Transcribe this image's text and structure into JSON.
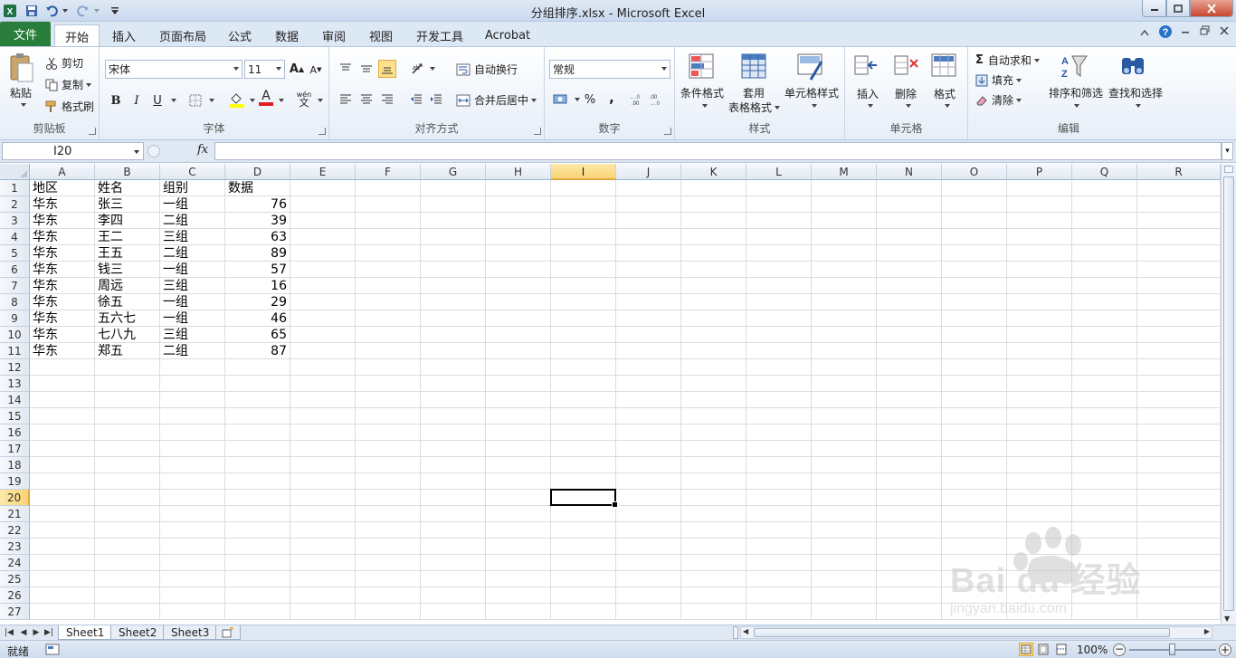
{
  "window": {
    "title": "分组排序.xlsx - Microsoft Excel"
  },
  "menu": {
    "tabs": [
      {
        "label": "文件"
      },
      {
        "label": "开始"
      },
      {
        "label": "插入"
      },
      {
        "label": "页面布局"
      },
      {
        "label": "公式"
      },
      {
        "label": "数据"
      },
      {
        "label": "审阅"
      },
      {
        "label": "视图"
      },
      {
        "label": "开发工具"
      },
      {
        "label": "Acrobat"
      }
    ],
    "active_tab": "开始"
  },
  "ribbon": {
    "clipboard": {
      "paste": "粘贴",
      "cut": "剪切",
      "copy": "复制",
      "format_painter": "格式刷",
      "label": "剪贴板"
    },
    "font": {
      "name": "宋体",
      "size": "11",
      "bold": "B",
      "italic": "I",
      "underline": "U",
      "label": "字体",
      "grow": "A",
      "shrink": "A",
      "color_a": "A",
      "phonetic": "wén"
    },
    "alignment": {
      "wrap_text": "自动换行",
      "merge_center": "合并后居中",
      "label": "对齐方式"
    },
    "number": {
      "format": "常规",
      "percent": "%",
      "comma": ",",
      "label": "数字"
    },
    "styles": {
      "conditional": "条件格式",
      "table_format_1": "套用",
      "table_format_2": "表格格式",
      "cell_styles": "单元格样式",
      "label": "样式"
    },
    "cells": {
      "insert": "插入",
      "delete": "删除",
      "format": "格式",
      "label": "单元格"
    },
    "editing": {
      "autosum": "自动求和",
      "fill": "填充",
      "clear": "清除",
      "sort_filter": "排序和筛选",
      "find_select": "查找和选择",
      "label": "编辑",
      "sigma": "Σ"
    }
  },
  "formula_bar": {
    "name_box": "I20",
    "fx": "fx",
    "value": ""
  },
  "sheet": {
    "columns": [
      "A",
      "B",
      "C",
      "D",
      "E",
      "F",
      "G",
      "H",
      "I",
      "J",
      "K",
      "L",
      "M",
      "N",
      "O",
      "P",
      "Q",
      "R"
    ],
    "row_numbers": [
      "1",
      "2",
      "3",
      "4",
      "5",
      "6",
      "7",
      "8",
      "9",
      "10",
      "11",
      "12",
      "13",
      "14",
      "15",
      "16",
      "17",
      "18",
      "19",
      "20",
      "21",
      "22",
      "23",
      "24",
      "25",
      "26",
      "27"
    ],
    "selected_column": "I",
    "selected_row": "20",
    "rows": [
      [
        "地区",
        "姓名",
        "组别",
        "数据"
      ],
      [
        "华东",
        "张三",
        "一组",
        "76"
      ],
      [
        "华东",
        "李四",
        "二组",
        "39"
      ],
      [
        "华东",
        "王二",
        "三组",
        "63"
      ],
      [
        "华东",
        "王五",
        "二组",
        "89"
      ],
      [
        "华东",
        "钱三",
        "一组",
        "57"
      ],
      [
        "华东",
        "周远",
        "三组",
        "16"
      ],
      [
        "华东",
        "徐五",
        "一组",
        "29"
      ],
      [
        "华东",
        "五六七",
        "一组",
        "46"
      ],
      [
        "华东",
        "七八九",
        "三组",
        "65"
      ],
      [
        "华东",
        "郑五",
        "二组",
        "87"
      ]
    ]
  },
  "sheet_tabs": [
    "Sheet1",
    "Sheet2",
    "Sheet3"
  ],
  "active_sheet": "Sheet1",
  "status": {
    "mode": "就绪",
    "zoom": "100%"
  },
  "watermark": {
    "brand": "Bai du 经验",
    "url": "jingyan.baidu.com"
  },
  "colors": {
    "file_tab": "#2a7e3b",
    "selection_header": "#f9d477",
    "ribbon_bg": "#e6eef8"
  }
}
